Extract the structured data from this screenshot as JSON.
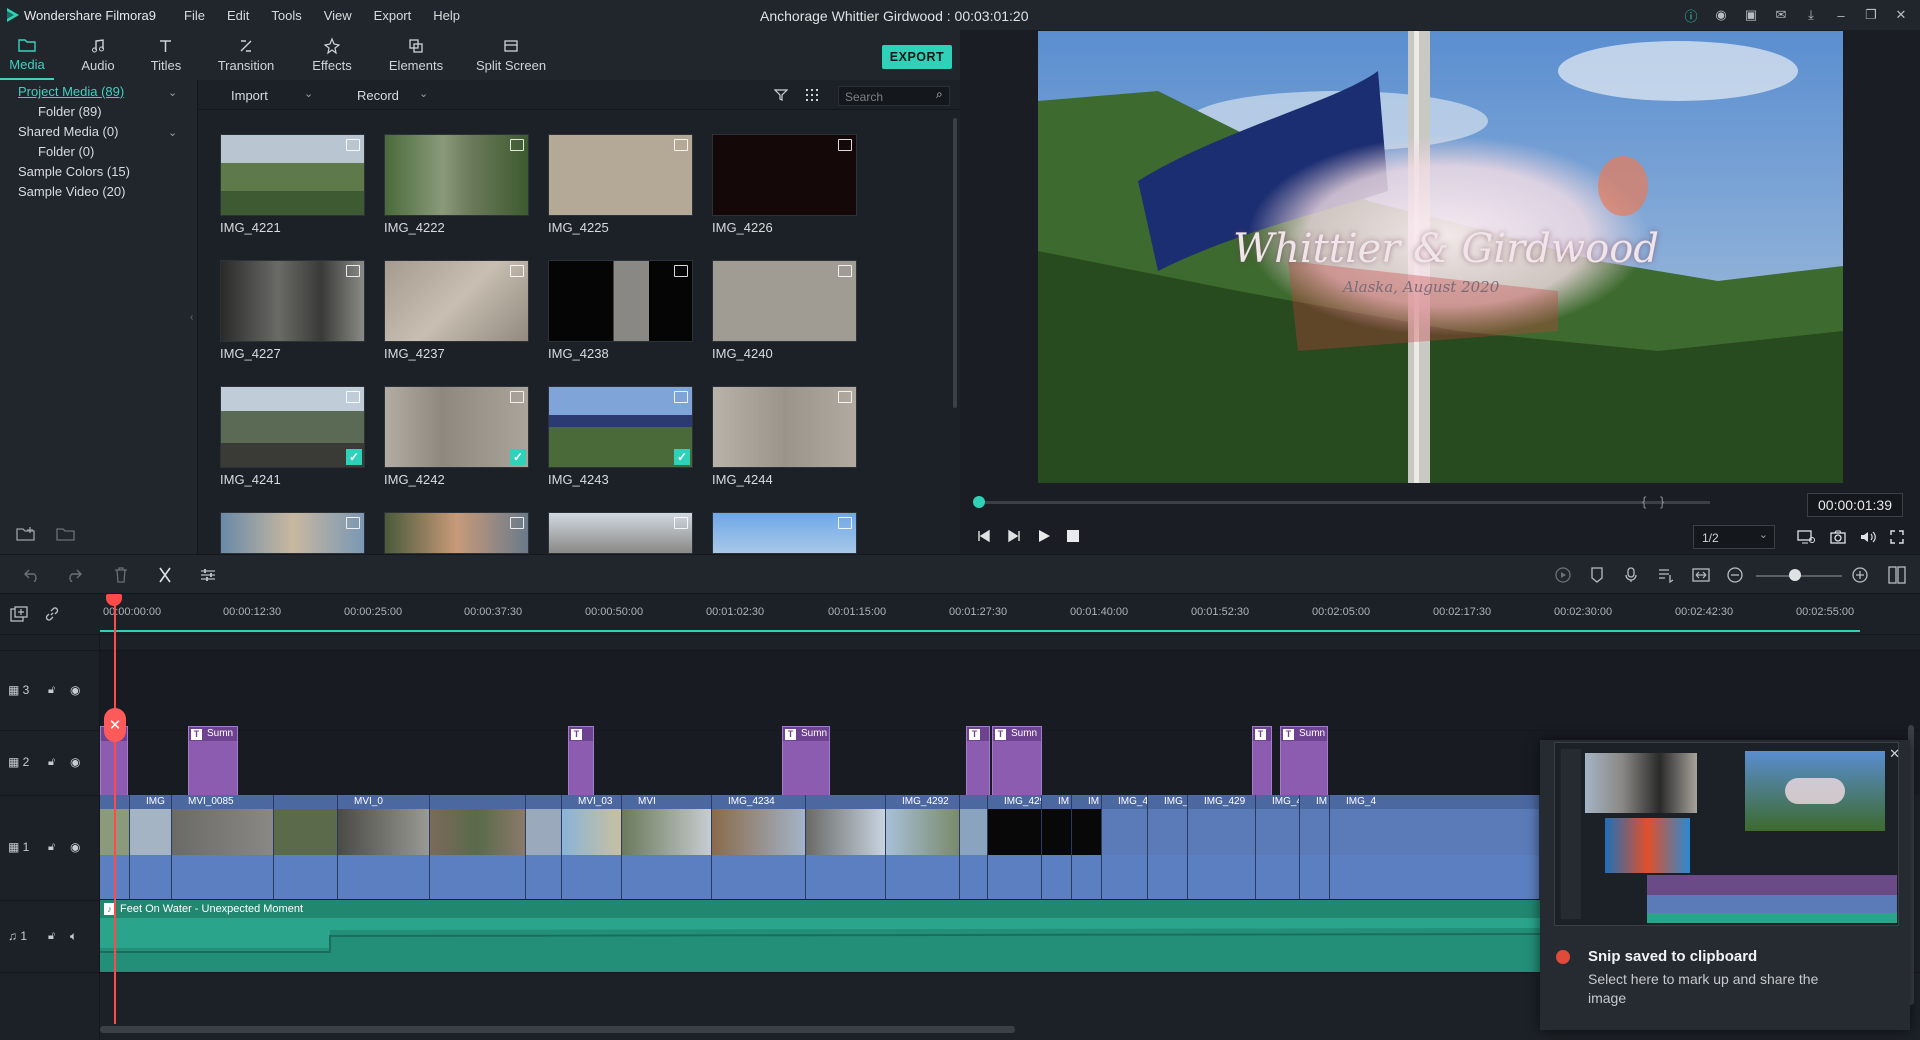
{
  "app": {
    "name": "Wondershare Filmora9",
    "window_title": "Anchorage Whittier Girdwood : 00:03:01:20"
  },
  "menu": [
    "File",
    "Edit",
    "Tools",
    "View",
    "Export",
    "Help"
  ],
  "tabs": [
    {
      "label": "Media",
      "icon": "folder-icon",
      "active": true
    },
    {
      "label": "Audio",
      "icon": "music-note-icon"
    },
    {
      "label": "Titles",
      "icon": "text-icon"
    },
    {
      "label": "Transition",
      "icon": "transition-icon"
    },
    {
      "label": "Effects",
      "icon": "effects-icon"
    },
    {
      "label": "Elements",
      "icon": "elements-icon"
    },
    {
      "label": "Split Screen",
      "icon": "split-screen-icon"
    }
  ],
  "export_label": "EXPORT",
  "library": [
    {
      "label": "Project Media (89)",
      "selected": true
    },
    {
      "label": "Folder (89)"
    },
    {
      "label": "Shared Media (0)"
    },
    {
      "label": "Folder (0)"
    },
    {
      "label": "Sample Colors (15)"
    },
    {
      "label": "Sample Video (20)"
    }
  ],
  "media_toolbar": {
    "import": "Import",
    "record": "Record",
    "search_placeholder": "Search"
  },
  "media_items": [
    {
      "label": "IMG_4221",
      "checked": false
    },
    {
      "label": "IMG_4222",
      "checked": false
    },
    {
      "label": "IMG_4225",
      "checked": false
    },
    {
      "label": "IMG_4226",
      "checked": false
    },
    {
      "label": "IMG_4227",
      "checked": false
    },
    {
      "label": "IMG_4237",
      "checked": false
    },
    {
      "label": "IMG_4238",
      "checked": false
    },
    {
      "label": "IMG_4240",
      "checked": false
    },
    {
      "label": "IMG_4241",
      "checked": true
    },
    {
      "label": "IMG_4242",
      "checked": true
    },
    {
      "label": "IMG_4243",
      "checked": true
    },
    {
      "label": "IMG_4244",
      "checked": false
    }
  ],
  "preview": {
    "title": "Whittier & Girdwood",
    "subtitle": "Alaska, August 2020",
    "timecode": "00:00:01:39",
    "ratio": "1/2"
  },
  "ruler": [
    "00:00:00:00",
    "00:00:12:30",
    "00:00:25:00",
    "00:00:37:30",
    "00:00:50:00",
    "00:01:02:30",
    "00:01:15:00",
    "00:01:27:30",
    "00:01:40:00",
    "00:01:52:30",
    "00:02:05:00",
    "00:02:17:30",
    "00:02:30:00",
    "00:02:42:30",
    "00:02:55:00"
  ],
  "tracks": {
    "t3": "3",
    "t2": "2",
    "t1": "1",
    "a1": "1"
  },
  "title_clips": [
    "Sumn",
    "Sumn",
    "Sumn",
    "Sumn",
    "Sumn"
  ],
  "video_clips": [
    "IMG",
    "MVI_0085",
    "MVI_0",
    "MVI_03",
    "MVI",
    "IMG_4234",
    "IMG_4292",
    "IMG_429",
    "IM",
    "IM",
    "IMG_4",
    "IMG_",
    "IMG_429",
    "IMG_42",
    "IM",
    "IMG_4"
  ],
  "audio_clip": "Feet On Water - Unexpected Moment",
  "toast": {
    "title": "Snip saved to clipboard",
    "body": "Select here to mark up and share the image"
  },
  "colors": {
    "accent": "#2fd2b8",
    "title_clip": "#8c5cb0",
    "video_clip": "#5a7ab8",
    "audio_clip": "#2aa58c",
    "playhead": "#ff4a4a"
  }
}
